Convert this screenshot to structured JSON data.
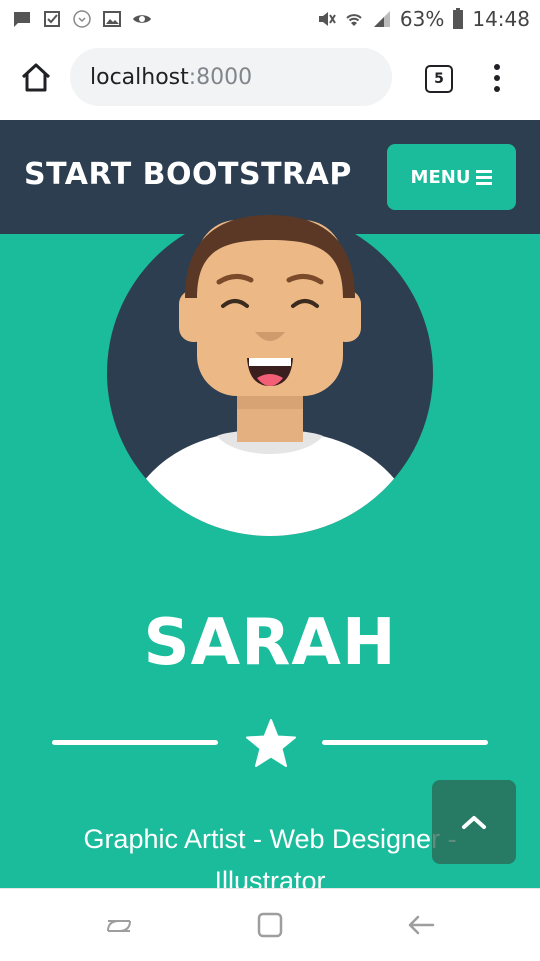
{
  "status_bar": {
    "battery_percent": "63%",
    "time": "14:48",
    "left_icons": [
      "message-icon",
      "checkbox-icon",
      "app-icon",
      "gallery-icon",
      "eye-icon"
    ],
    "right_icons": [
      "mute-icon",
      "wifi-icon",
      "signal-icon",
      "battery-icon"
    ]
  },
  "browser": {
    "url_host": "localhost",
    "url_port": ":8000",
    "tab_count": "5"
  },
  "navbar": {
    "brand": "START BOOTSTRAP",
    "menu_label": "MENU",
    "colors": {
      "navbar_bg": "#2c3e50",
      "accent": "#1abc9c"
    }
  },
  "masthead": {
    "heading": "SARAH",
    "subheading": "Graphic Artist - Web Designer - Illustrator",
    "bg_color": "#1abc9c"
  },
  "icons": {
    "divider": "star-icon",
    "scroll_top": "chevron-up-icon",
    "system_nav": [
      "recent-apps-icon",
      "home-icon",
      "back-icon"
    ]
  }
}
